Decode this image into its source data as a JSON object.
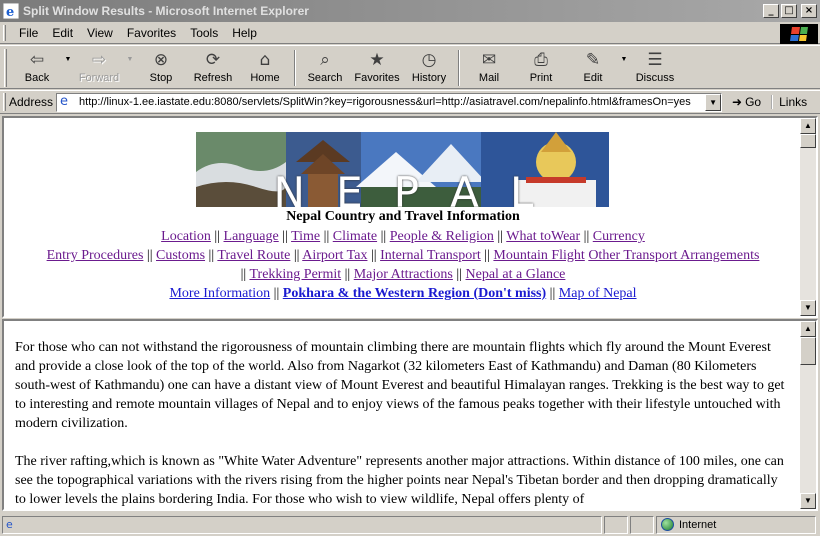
{
  "window": {
    "title": "Split Window Results - Microsoft Internet Explorer"
  },
  "menu": [
    {
      "label": "File"
    },
    {
      "label": "Edit"
    },
    {
      "label": "View"
    },
    {
      "label": "Favorites"
    },
    {
      "label": "Tools"
    },
    {
      "label": "Help"
    }
  ],
  "toolbar": {
    "back": "Back",
    "forward": "Forward",
    "stop": "Stop",
    "refresh": "Refresh",
    "home": "Home",
    "search": "Search",
    "favorites": "Favorites",
    "history": "History",
    "mail": "Mail",
    "print": "Print",
    "edit": "Edit",
    "discuss": "Discuss"
  },
  "address": {
    "label": "Address",
    "url": "http://linux-1.ee.iastate.edu:8080/servlets/SplitWin?key=rigorousness&url=http://asiatravel.com/nepalinfo.html&framesOn=yes",
    "go": "Go",
    "links": "Links"
  },
  "top_frame": {
    "banner_letters": [
      "N",
      "E",
      "P",
      "A",
      "L"
    ],
    "heading": "Nepal Country and Travel Information",
    "nav_row1": [
      "Location",
      "Language",
      "Time",
      "Climate",
      "People & Religion",
      "What toWear",
      "Currency"
    ],
    "nav_row2": [
      "Entry Procedures",
      "Customs",
      "Travel Route",
      "Airport Tax",
      "Internal Transport",
      "Mountain Flight",
      "Other Transport Arrangements"
    ],
    "nav_row3": [
      "Trekking Permit",
      "Major Attractions",
      "Nepal at a Glance"
    ],
    "nav_row4": [
      "More Information",
      "Pokhara & the Western Region (Don't miss)",
      "Map of Nepal"
    ],
    "separator": "||"
  },
  "bottom_frame": {
    "paragraphs": [
      "For those who can not withstand the rigorousness of mountain climbing there are mountain flights which fly around the Mount Everest and provide a close look of the top of the world. Also from Nagarkot (32 kilometers East of Kathmandu) and Daman (80 Kilometers south-west of Kathmandu) one can have a distant view of Mount Everest and beautiful Himalayan ranges. Trekking is the best way to get to interesting and remote mountain villages of Nepal and to enjoy views of the famous peaks together with their lifestyle untouched with modern civilization.",
      "The river rafting,which is known as \"White Water Adventure\" represents another major attractions. Within distance of 100 miles, one can see the topographical variations with the rivers rising from the higher points near Nepal's Tibetan border and then dropping dramatically to lower levels the plains bordering India. For those who wish to view wildlife, Nepal offers plenty of"
    ]
  },
  "status": {
    "text": "",
    "zone": "Internet"
  },
  "colors": {
    "visited_link": "#6b1b8e",
    "unvisited_link": "#1a1ad0",
    "chrome": "#d4d0c8"
  }
}
